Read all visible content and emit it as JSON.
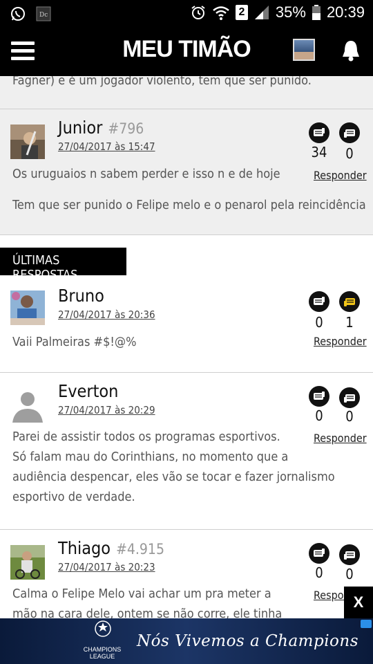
{
  "status_bar": {
    "battery": "35%",
    "time": "20:39",
    "sim": "2"
  },
  "app": {
    "title": "MEU TIMÃO"
  },
  "previous_comment": {
    "text_tail": "Fagner) e é um jogador violento, tem que ser punido."
  },
  "featured_comment": {
    "name": "Junior",
    "number": "#796",
    "date": "27/04/2017 às 15:47",
    "line1": "Os uruguaios n sabem perder e isso n e de hoje",
    "line2": "Tem que ser punido o Felipe melo e o penarol pela reincidência",
    "up_votes": "34",
    "down_votes": "0",
    "reply_label": "Responder"
  },
  "section": {
    "title": "ÚLTIMAS RESPOSTAS"
  },
  "replies": [
    {
      "name": "Bruno",
      "date": "27/04/2017 às 20:36",
      "text": "Vaii Palmeiras #$!@%",
      "up_votes": "0",
      "down_votes": "1",
      "reply_label": "Responder"
    },
    {
      "name": "Everton",
      "date": "27/04/2017 às 20:29",
      "lines": [
        "Parei de assistir todos os programas esportivos.",
        "Só falam mau do Corinthians, no momento que a",
        "audiência despencar, eles vão se tocar e fazer jornalismo",
        "esportivo de verdade."
      ],
      "up_votes": "0",
      "down_votes": "0",
      "reply_label": "Responder"
    },
    {
      "name": "Thiago",
      "number": "#4.915",
      "date": "27/04/2017 às 20:23",
      "lines": [
        "Calma o Felipe Melo vai achar um pra meter a",
        "mão na cara dele, ontem se não corre, ele tinha"
      ],
      "up_votes": "0",
      "down_votes": "0",
      "reply_label": "Respon"
    }
  ],
  "ad": {
    "close_label": "X",
    "brand": "CHAMPIONS LEAGUE",
    "slogan": "Nós Vivemos a Champions"
  },
  "colors": {
    "header_bg": "#000000",
    "featured_bg": "#efefef",
    "vote_up_icon": "#111111",
    "vote_highlight": "#f0c419"
  }
}
